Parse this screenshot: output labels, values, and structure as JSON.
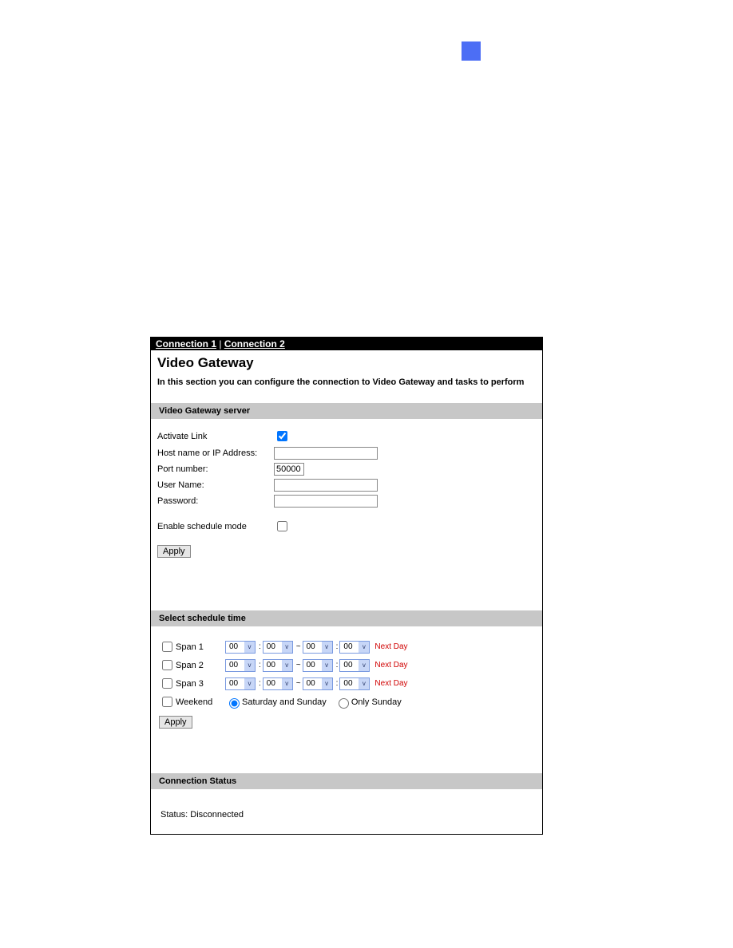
{
  "tabs": {
    "conn1": "Connection 1",
    "sep": " | ",
    "conn2": "Connection 2"
  },
  "title": "Video Gateway",
  "subtitle": "In this section you can configure the connection to Video Gateway and tasks to perform",
  "sections": {
    "server": {
      "header": "Video Gateway server",
      "activate": {
        "label": "Activate Link",
        "checked": true
      },
      "host": {
        "label": "Host name or IP Address:",
        "value": ""
      },
      "port": {
        "label": "Port number:",
        "value": "50000"
      },
      "user": {
        "label": "User Name:",
        "value": ""
      },
      "pass": {
        "label": "Password:",
        "value": ""
      },
      "schedmode": {
        "label": "Enable schedule mode",
        "checked": false
      },
      "apply": "Apply"
    },
    "schedule": {
      "header": "Select schedule time",
      "spans": [
        {
          "label": "Span 1",
          "h1": "00",
          "m1": "00",
          "h2": "00",
          "m2": "00",
          "nextday": "Next Day"
        },
        {
          "label": "Span 2",
          "h1": "00",
          "m1": "00",
          "h2": "00",
          "m2": "00",
          "nextday": "Next Day"
        },
        {
          "label": "Span 3",
          "h1": "00",
          "m1": "00",
          "h2": "00",
          "m2": "00",
          "nextday": "Next Day"
        }
      ],
      "weekend": {
        "label": "Weekend",
        "satSun": "Saturday and Sunday",
        "onlySun": "Only Sunday",
        "selected": "satSun"
      },
      "apply": "Apply"
    },
    "status": {
      "header": "Connection Status",
      "text": "Status: Disconnected"
    }
  },
  "glyphs": {
    "colon": ":",
    "tilde": "~",
    "dropdown": "v"
  }
}
